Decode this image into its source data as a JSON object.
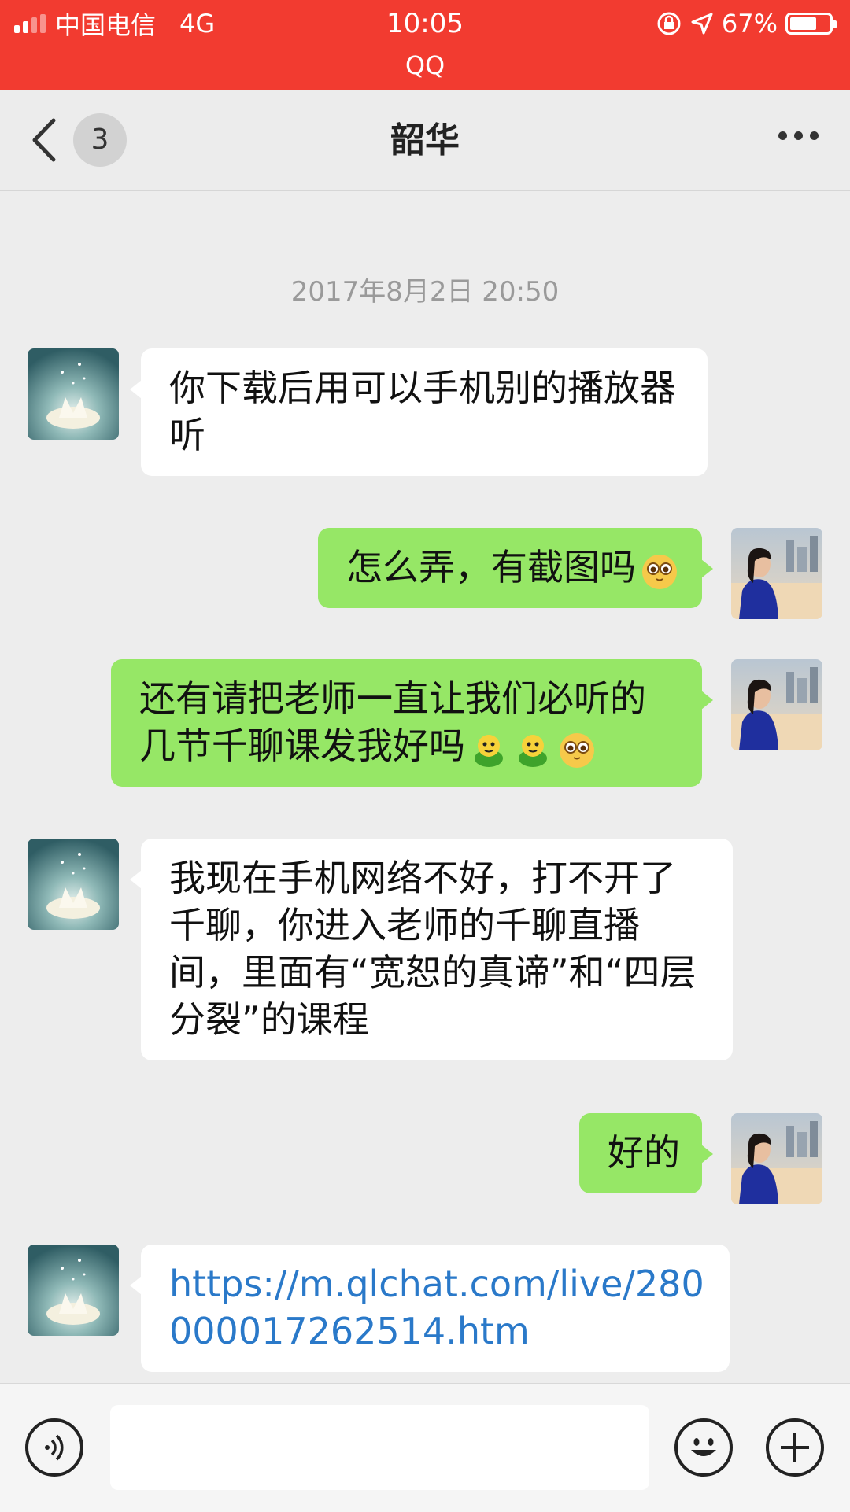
{
  "status_bar": {
    "carrier": "中国电信",
    "network": "4G",
    "time": "10:05",
    "app_name": "QQ",
    "battery_percent": "67%",
    "battery_level": 0.67,
    "bg_color": "#f23b30"
  },
  "nav": {
    "title": "韶华",
    "unread_count": "3"
  },
  "chat": {
    "timestamp": "2017年8月2日 20:50",
    "messages": [
      {
        "side": "left",
        "text": "你下载后用可以手机别的播放器听"
      },
      {
        "side": "right",
        "text": "怎么弄，有截图吗",
        "emojis": [
          "cute-face-emoji"
        ]
      },
      {
        "side": "right",
        "text": "还有请把老师一直让我们必听的几节千聊课发我好吗",
        "emojis": [
          "green-frog-emoji",
          "green-frog-emoji",
          "cute-face-emoji"
        ]
      },
      {
        "side": "left",
        "text": "我现在手机网络不好，打不开了千聊，你进入老师的千聊直播间，里面有“宽恕的真谛”和“四层分裂”的课程"
      },
      {
        "side": "right",
        "text": "好的"
      },
      {
        "side": "left",
        "text": "https://m.qlchat.com/live/280000017262514.htm",
        "is_link": true
      }
    ]
  },
  "colors": {
    "bubble_self": "#96e766",
    "bubble_other": "#ffffff",
    "link": "#2a79c9",
    "chat_bg": "#ededed"
  },
  "icons": [
    "back-arrow-icon",
    "more-icon",
    "voice-icon",
    "emoji-icon",
    "plus-icon",
    "location-icon",
    "lock-rotation-icon",
    "battery-icon",
    "signal-icon"
  ]
}
